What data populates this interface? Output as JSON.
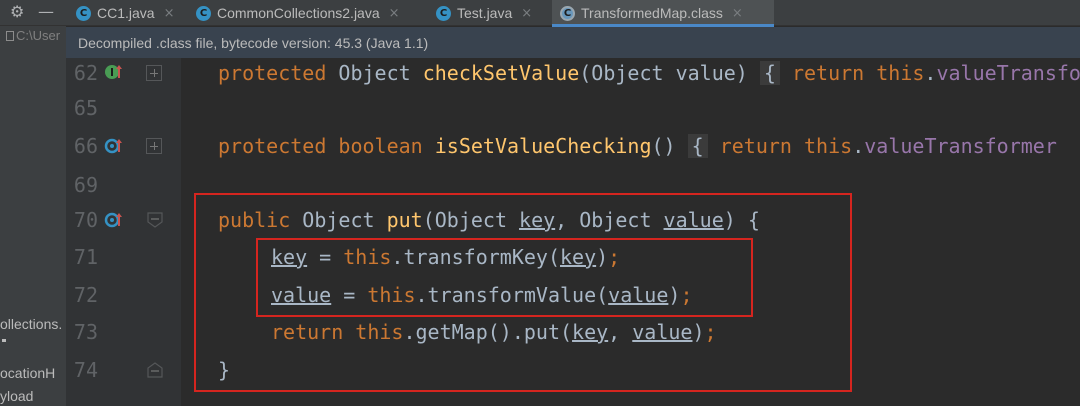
{
  "tabs": [
    {
      "label": "CC1.java",
      "icon": "java-class-icon",
      "close": "×"
    },
    {
      "label": "CommonCollections2.java",
      "icon": "java-class-icon",
      "close": "×"
    },
    {
      "label": "Test.java",
      "icon": "java-class-icon",
      "close": "×"
    },
    {
      "label": "TransformedMap.class",
      "icon": "compiled-class-icon",
      "close": "×",
      "active": true
    }
  ],
  "toolbar": {
    "settings_icon": "⚙",
    "hide_icon": "—"
  },
  "project_panel": {
    "path_text": "C:\\User",
    "items": [
      "ollections.",
      "ocationH",
      "yload"
    ]
  },
  "banner": {
    "text": "Decompiled .class file, bytecode version: 45.3 (Java 1.1)"
  },
  "editor": {
    "line_numbers": [
      "62",
      "65",
      "66",
      "69",
      "70",
      "71",
      "72",
      "73",
      "74"
    ],
    "lines": {
      "l62": {
        "t1": "protected",
        "t2": " Object ",
        "t3": "checkSetValue",
        "t4": "(Object value) ",
        "t5": "{",
        "t6": " return ",
        "t7": "this",
        "t8": ".",
        "t9": "valueTransformer"
      },
      "l66": {
        "t1": "protected",
        "t2": " ",
        "t3": "boolean",
        "t4": " ",
        "t5": "isSetValueChecking",
        "t6": "() ",
        "t7": "{",
        "t8": " return ",
        "t9": "this",
        "t10": ".",
        "t11": "valueTransformer"
      },
      "l70": {
        "t1": "public",
        "t2": " Object ",
        "t3": "put",
        "t4": "(Object ",
        "t5": "key",
        "t6": ", Object ",
        "t7": "value",
        "t8": ") {"
      },
      "l71": {
        "t1": "key",
        "t2": " = ",
        "t3": "this",
        "t4": ".transformKey(",
        "t5": "key",
        "t6": ")",
        "t7": ";"
      },
      "l72": {
        "t1": "value",
        "t2": " = ",
        "t3": "this",
        "t4": ".transformValue(",
        "t5": "value",
        "t6": ")",
        "t7": ";"
      },
      "l73": {
        "t1": "return",
        "t2": " ",
        "t3": "this",
        "t4": ".getMap().put(",
        "t5": "key",
        "t6": ", ",
        "t7": "value",
        "t8": ")",
        "t9": ";"
      },
      "l74": {
        "t1": "}"
      }
    }
  },
  "colors": {
    "keyword": "#cc7832",
    "method": "#ffc66d",
    "field": "#9876aa",
    "text": "#a9b7c6",
    "highlight_box": "#d5251f",
    "active_tab_underline": "#4a88c7"
  }
}
